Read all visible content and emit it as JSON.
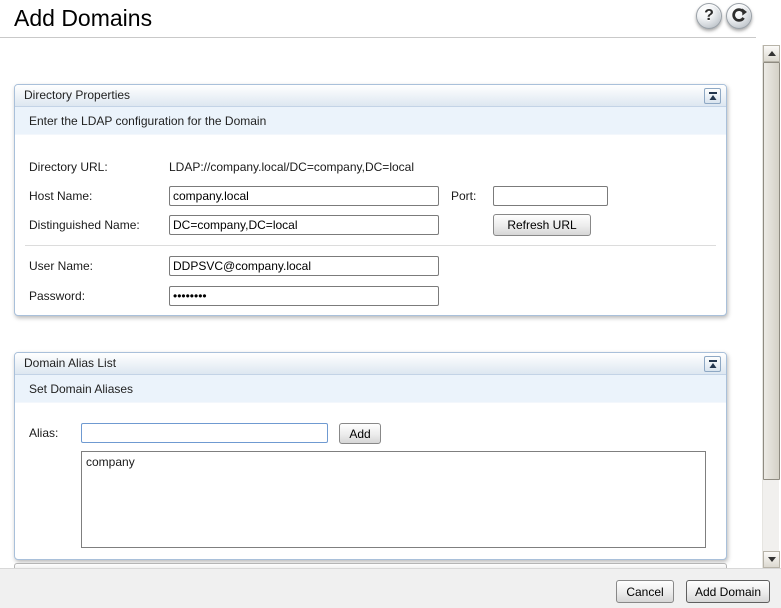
{
  "page": {
    "title": "Add Domains"
  },
  "toolbar": {
    "help_glyph": "?",
    "icons": {
      "help": "help-icon",
      "refresh": "refresh-icon",
      "collapse": "collapse-panel-icon"
    }
  },
  "directory_panel": {
    "title": "Directory Properties",
    "subtitle": "Enter the LDAP configuration for the Domain",
    "directory_url_label": "Directory URL:",
    "directory_url_value": "LDAP://company.local/DC=company,DC=local",
    "host_name_label": "Host Name:",
    "host_name_value": "company.local",
    "port_label": "Port:",
    "port_value": "",
    "distinguished_name_label": "Distinguished Name:",
    "distinguished_name_value": "DC=company,DC=local",
    "refresh_url_button": "Refresh URL",
    "user_name_label": "User Name:",
    "user_name_value": "DDPSVC@company.local",
    "password_label": "Password:",
    "password_value": "••••••••"
  },
  "alias_panel": {
    "title": "Domain Alias List",
    "subtitle": "Set Domain Aliases",
    "alias_label": "Alias:",
    "alias_value": "",
    "add_button": "Add",
    "aliases": [
      "company"
    ]
  },
  "footer": {
    "cancel_button": "Cancel",
    "add_domain_button": "Add Domain"
  },
  "colors": {
    "panel_border": "#a9c0da",
    "panel_header_gradient_bottom": "#dde7f1",
    "panel_subheader_bg": "#ebf3fb",
    "focus_input_border": "#6f9ad1",
    "footer_bg": "#f0f0f0",
    "button_border": "#888888"
  }
}
